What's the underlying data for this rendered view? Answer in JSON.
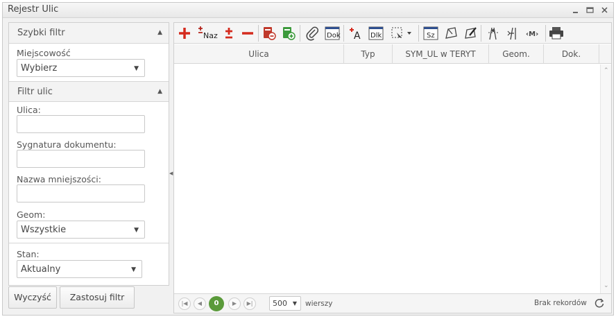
{
  "window": {
    "title": "Rejestr Ulic"
  },
  "quick_filter": {
    "header": "Szybki filtr",
    "locality_label": "Miejscowość",
    "locality_value": "Wybierz"
  },
  "street_filter": {
    "header": "Filtr ulic",
    "street_label": "Ulica:",
    "street_value": "",
    "doc_signature_label": "Sygnatura dokumentu:",
    "doc_signature_value": "",
    "locality_name_label": "Nazwa mniejszości:",
    "locality_name_value": "",
    "geom_label": "Geom:",
    "geom_value": "Wszystkie",
    "status_label": "Stan:",
    "status_value": "Aktualny"
  },
  "buttons": {
    "clear": "Wyczyść",
    "apply": "Zastosuj filtr"
  },
  "toolbar": {
    "naz_label": "Naz",
    "dok_label": "Dok",
    "a_label": "A",
    "dlk_label": "Dlk",
    "sz_label": "Sz"
  },
  "grid": {
    "columns": [
      "Ulica",
      "Typ",
      "SYM_UL w TERYT",
      "Geom.",
      "Dok."
    ]
  },
  "pager": {
    "current_page": "0",
    "rows_per_page": "500",
    "rows_label": "wierszy",
    "records_status": "Brak rekordów"
  },
  "colors": {
    "red": "#d42b1e",
    "green": "#3c9a3c",
    "pager_green": "#5a9a3a"
  }
}
